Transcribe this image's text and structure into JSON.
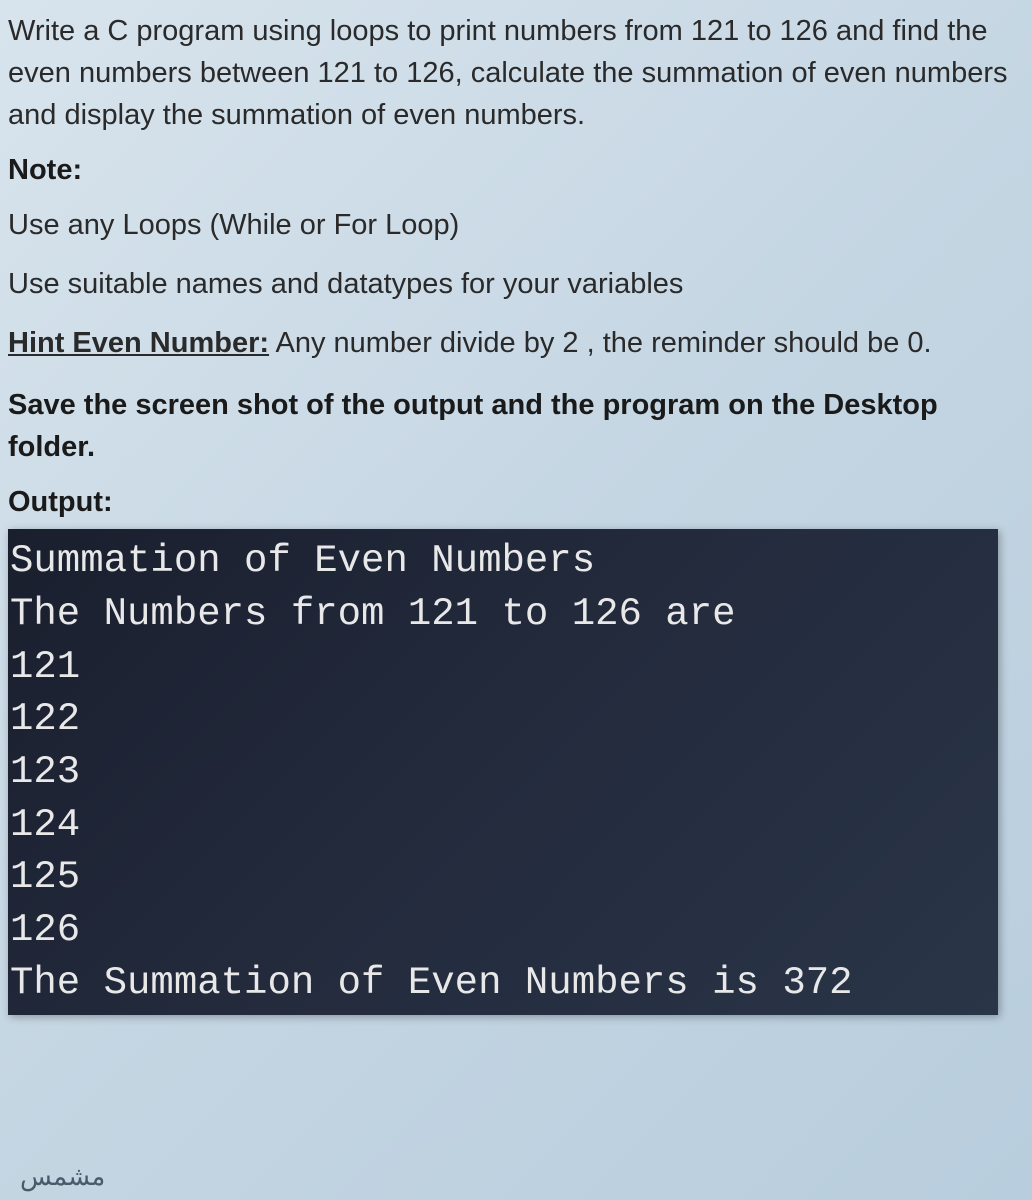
{
  "question": {
    "text": "Write a C program using loops to print numbers from 121 to 126 and find the even numbers between 121 to 126, calculate the summation of even numbers and display the summation of even numbers."
  },
  "note": {
    "heading": "Note:",
    "instructions": [
      "Use any Loops (While or For Loop)",
      "Use suitable names and datatypes for your variables"
    ]
  },
  "hint": {
    "label": "Hint Even Number:",
    "text": " Any number divide by 2 , the reminder should be 0."
  },
  "save_instruction": "Save the screen shot of the output and the program on the Desktop folder.",
  "output": {
    "heading": "Output:",
    "lines": [
      "Summation of Even Numbers",
      "The Numbers from 121 to 126 are",
      "121",
      "122",
      "123",
      "124",
      "125",
      "126",
      "The Summation of Even Numbers is 372"
    ]
  },
  "arabic_label": "مشمس"
}
